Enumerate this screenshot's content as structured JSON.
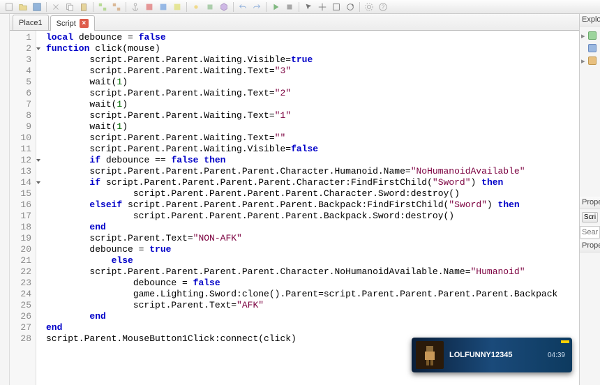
{
  "tabs": [
    {
      "label": "Place1",
      "closable": false
    },
    {
      "label": "Script",
      "closable": true
    }
  ],
  "active_tab": 1,
  "code_lines": [
    {
      "n": 1,
      "indent": 0,
      "fold": false,
      "tokens": [
        [
          "kw",
          "local"
        ],
        [
          "",
          " debounce = "
        ],
        [
          "bool",
          "false"
        ]
      ]
    },
    {
      "n": 2,
      "indent": 0,
      "fold": true,
      "tokens": [
        [
          "kw",
          "function"
        ],
        [
          "",
          " click(mouse)"
        ]
      ]
    },
    {
      "n": 3,
      "indent": 2,
      "fold": false,
      "tokens": [
        [
          "",
          "script.Parent.Parent.Waiting.Visible="
        ],
        [
          "bool",
          "true"
        ]
      ]
    },
    {
      "n": 4,
      "indent": 2,
      "fold": false,
      "tokens": [
        [
          "",
          "script.Parent.Parent.Waiting.Text="
        ],
        [
          "str",
          "\"3\""
        ]
      ]
    },
    {
      "n": 5,
      "indent": 2,
      "fold": false,
      "tokens": [
        [
          "",
          "wait("
        ],
        [
          "num",
          "1"
        ],
        [
          "",
          ")"
        ]
      ]
    },
    {
      "n": 6,
      "indent": 2,
      "fold": false,
      "tokens": [
        [
          "",
          "script.Parent.Parent.Waiting.Text="
        ],
        [
          "str",
          "\"2\""
        ]
      ]
    },
    {
      "n": 7,
      "indent": 2,
      "fold": false,
      "tokens": [
        [
          "",
          "wait("
        ],
        [
          "num",
          "1"
        ],
        [
          "",
          ")"
        ]
      ]
    },
    {
      "n": 8,
      "indent": 2,
      "fold": false,
      "tokens": [
        [
          "",
          "script.Parent.Parent.Waiting.Text="
        ],
        [
          "str",
          "\"1\""
        ]
      ]
    },
    {
      "n": 9,
      "indent": 2,
      "fold": false,
      "tokens": [
        [
          "",
          "wait("
        ],
        [
          "num",
          "1"
        ],
        [
          "",
          ")"
        ]
      ]
    },
    {
      "n": 10,
      "indent": 2,
      "fold": false,
      "tokens": [
        [
          "",
          "script.Parent.Parent.Waiting.Text="
        ],
        [
          "str",
          "\"\""
        ]
      ]
    },
    {
      "n": 11,
      "indent": 2,
      "fold": false,
      "tokens": [
        [
          "",
          "script.Parent.Parent.Waiting.Visible="
        ],
        [
          "bool",
          "false"
        ]
      ]
    },
    {
      "n": 12,
      "indent": 2,
      "fold": true,
      "tokens": [
        [
          "kw",
          "if"
        ],
        [
          "",
          " debounce == "
        ],
        [
          "bool",
          "false"
        ],
        [
          "",
          " "
        ],
        [
          "kw",
          "then"
        ]
      ]
    },
    {
      "n": 13,
      "indent": 2,
      "fold": false,
      "tokens": [
        [
          "",
          "script.Parent.Parent.Parent.Parent.Character.Humanoid.Name="
        ],
        [
          "str",
          "\"NoHumanoidAvailable\""
        ]
      ]
    },
    {
      "n": 14,
      "indent": 2,
      "fold": true,
      "tokens": [
        [
          "kw",
          "if"
        ],
        [
          "",
          " script.Parent.Parent.Parent.Parent.Character:FindFirstChild("
        ],
        [
          "str",
          "\"Sword\""
        ],
        [
          "",
          ") "
        ],
        [
          "kw",
          "then"
        ]
      ]
    },
    {
      "n": 15,
      "indent": 4,
      "fold": false,
      "tokens": [
        [
          "",
          "script.Parent.Parent.Parent.Parent.Character.Sword:destroy()"
        ]
      ]
    },
    {
      "n": 16,
      "indent": 2,
      "fold": false,
      "tokens": [
        [
          "kw",
          "elseif"
        ],
        [
          "",
          " script.Parent.Parent.Parent.Parent.Backpack:FindFirstChild("
        ],
        [
          "str",
          "\"Sword\""
        ],
        [
          "",
          ") "
        ],
        [
          "kw",
          "then"
        ]
      ]
    },
    {
      "n": 17,
      "indent": 4,
      "fold": false,
      "tokens": [
        [
          "",
          "script.Parent.Parent.Parent.Parent.Backpack.Sword:destroy()"
        ]
      ]
    },
    {
      "n": 18,
      "indent": 2,
      "fold": false,
      "tokens": [
        [
          "kw",
          "end"
        ]
      ]
    },
    {
      "n": 19,
      "indent": 2,
      "fold": false,
      "tokens": [
        [
          "",
          "script.Parent.Text="
        ],
        [
          "str",
          "\"NON-AFK\""
        ]
      ]
    },
    {
      "n": 20,
      "indent": 2,
      "fold": false,
      "tokens": [
        [
          "",
          "debounce = "
        ],
        [
          "bool",
          "true"
        ]
      ]
    },
    {
      "n": 21,
      "indent": 3,
      "fold": false,
      "tokens": [
        [
          "kw",
          "else"
        ]
      ]
    },
    {
      "n": 22,
      "indent": 2,
      "fold": false,
      "tokens": [
        [
          "",
          "script.Parent.Parent.Parent.Parent.Character.NoHumanoidAvailable.Name="
        ],
        [
          "str",
          "\"Humanoid\""
        ]
      ]
    },
    {
      "n": 23,
      "indent": 4,
      "fold": false,
      "tokens": [
        [
          "",
          "debounce = "
        ],
        [
          "bool",
          "false"
        ]
      ]
    },
    {
      "n": 24,
      "indent": 4,
      "fold": false,
      "tokens": [
        [
          "",
          "game.Lighting.Sword:clone().Parent=script.Parent.Parent.Parent.Parent.Backpack"
        ]
      ]
    },
    {
      "n": 25,
      "indent": 4,
      "fold": false,
      "tokens": [
        [
          "",
          "script.Parent.Text="
        ],
        [
          "str",
          "\"AFK\""
        ]
      ]
    },
    {
      "n": 26,
      "indent": 2,
      "fold": false,
      "tokens": [
        [
          "kw",
          "end"
        ]
      ]
    },
    {
      "n": 27,
      "indent": 0,
      "fold": false,
      "tokens": [
        [
          "kw",
          "end"
        ]
      ]
    },
    {
      "n": 28,
      "indent": 0,
      "fold": false,
      "tokens": [
        [
          "",
          "script.Parent.MouseButton1Click:connect(click)"
        ]
      ]
    }
  ],
  "panels": {
    "explorer": "Explor",
    "properties": "Prope",
    "script_btn": "Scri",
    "search_placeholder": "Searc"
  },
  "toast": {
    "username": "LOLFUNNY12345",
    "timestamp": "04:39"
  }
}
